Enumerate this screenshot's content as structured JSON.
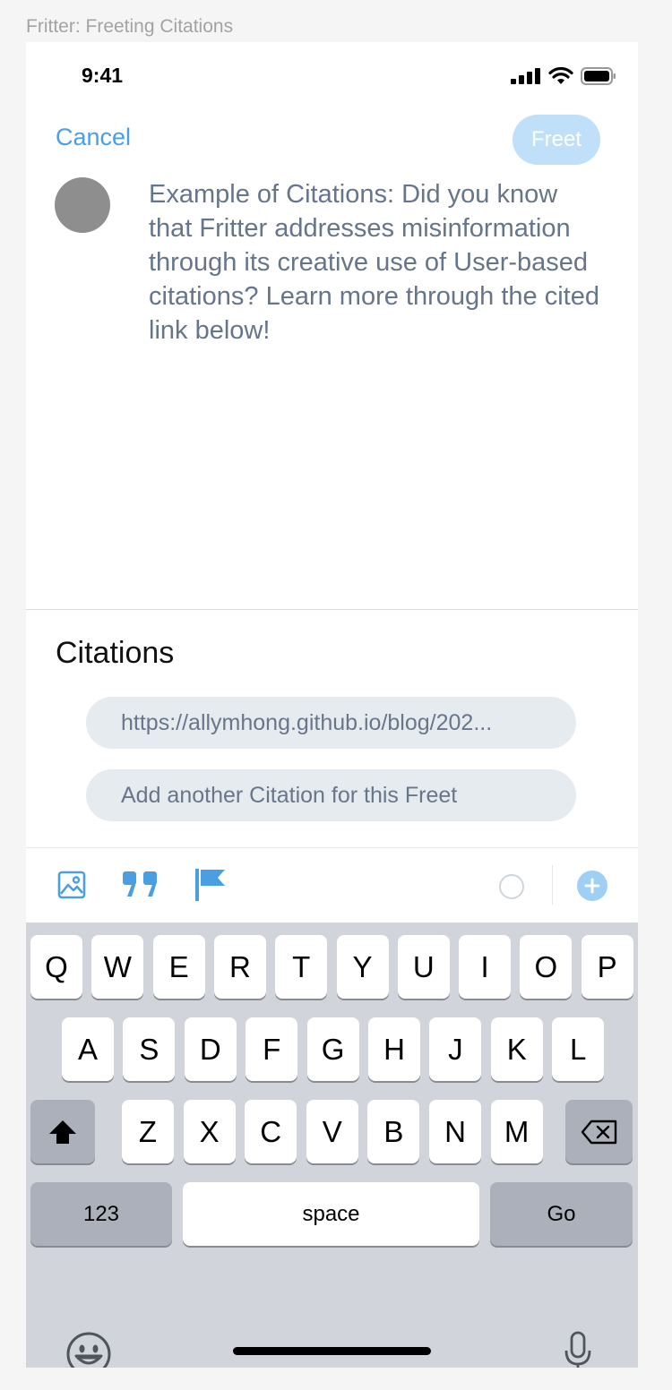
{
  "frame_title": "Fritter: Freeting Citations",
  "status_bar": {
    "time": "9:41"
  },
  "compose": {
    "cancel_label": "Cancel",
    "freet_label": "Freet",
    "text": "Example of Citations: Did you know that Fritter addresses misinformation through its creative use of User-based citations? Learn more through the cited link below!"
  },
  "citations": {
    "heading": "Citations",
    "items": [
      {
        "value": "https://allymhong.github.io/blog/202..."
      }
    ],
    "add_placeholder": "Add another Citation for this Freet"
  },
  "toolbar": {
    "icons": [
      "image-icon",
      "quote-icon",
      "flag-icon",
      "progress-ring-icon",
      "add-icon"
    ],
    "accent_color": "#4a9fe3"
  },
  "keyboard": {
    "row1": [
      "Q",
      "W",
      "E",
      "R",
      "T",
      "Y",
      "U",
      "I",
      "O",
      "P"
    ],
    "row2": [
      "A",
      "S",
      "D",
      "F",
      "G",
      "H",
      "J",
      "K",
      "L"
    ],
    "row3": [
      "Z",
      "X",
      "C",
      "V",
      "B",
      "N",
      "M"
    ],
    "numbers_label": "123",
    "space_label": "space",
    "go_label": "Go"
  }
}
